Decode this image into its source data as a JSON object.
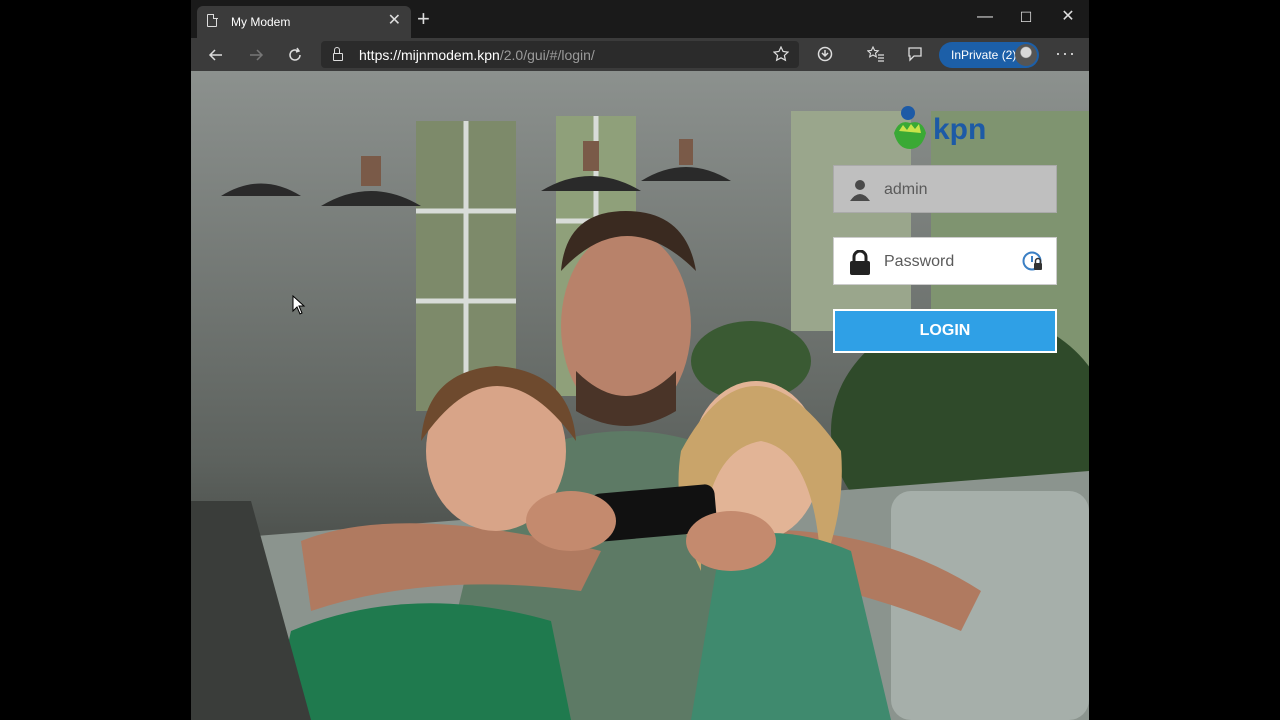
{
  "browser": {
    "tab_title": "My Modem",
    "tab_close": "✕",
    "new_tab": "+",
    "url_main": "https://mijnmodem.kpn",
    "url_rest": "/2.0/gui/#/login/",
    "inprivate_label": "InPrivate (2)",
    "minimize": "—",
    "maximize": "☐",
    "close": "✕",
    "more": "···"
  },
  "login": {
    "username_value": "admin",
    "password_placeholder": "Password",
    "login_label": "LOGIN"
  },
  "logo": {
    "text": "kpn"
  },
  "icons": [
    "page-icon",
    "back-icon",
    "forward-icon",
    "refresh-icon",
    "lock-icon",
    "star-icon",
    "tracking-icon",
    "favorites-icon",
    "feedback-icon",
    "avatar",
    "user-icon",
    "padlock-icon",
    "password-manager-icon",
    "cursor-icon"
  ],
  "colors": {
    "accent": "#2fa0e6",
    "kpn_green": "#3aa935",
    "kpn_blue": "#1d5aa6",
    "inprivate": "#1c5fa8"
  }
}
